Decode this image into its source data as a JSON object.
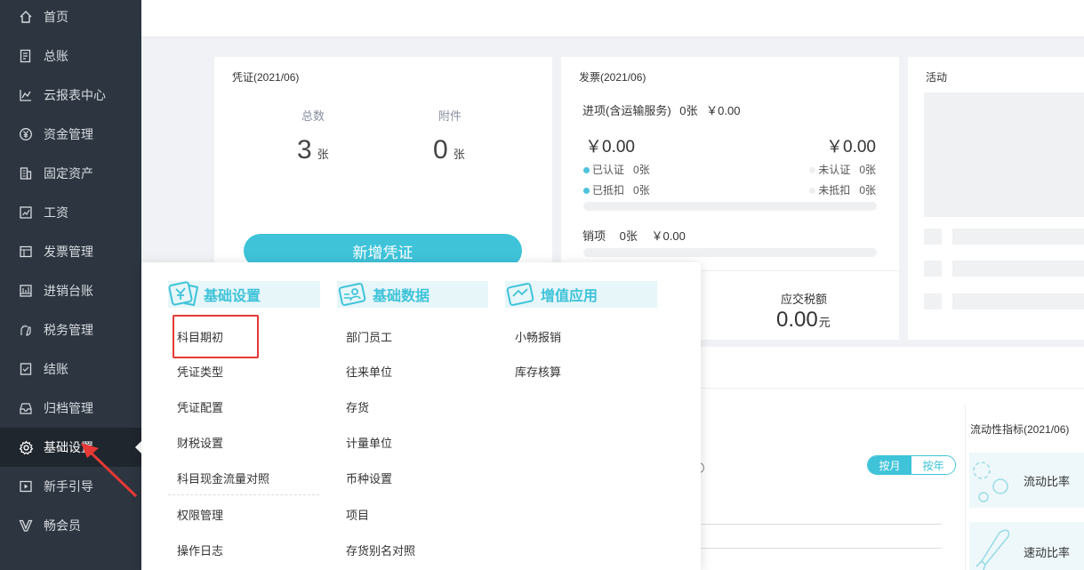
{
  "sidebar": {
    "items": [
      {
        "label": "首页",
        "icon": "home-icon"
      },
      {
        "label": "总账",
        "icon": "ledger-icon"
      },
      {
        "label": "云报表中心",
        "icon": "report-chart-icon"
      },
      {
        "label": "资金管理",
        "icon": "yen-wallet-icon"
      },
      {
        "label": "固定资产",
        "icon": "building-icon"
      },
      {
        "label": "工资",
        "icon": "salary-chart-icon"
      },
      {
        "label": "发票管理",
        "icon": "invoice-icon"
      },
      {
        "label": "进销台账",
        "icon": "stock-ledger-icon"
      },
      {
        "label": "税务管理",
        "icon": "tax-hand-icon"
      },
      {
        "label": "结账",
        "icon": "close-account-icon"
      },
      {
        "label": "归档管理",
        "icon": "archive-icon"
      },
      {
        "label": "基础设置",
        "icon": "gear-icon"
      },
      {
        "label": "新手引导",
        "icon": "play-guide-icon"
      },
      {
        "label": "畅会员",
        "icon": "vip-v-icon"
      }
    ],
    "active_index": 11
  },
  "voucher": {
    "title": "凭证(2021/06)",
    "total_label": "总数",
    "total_value": "3",
    "attach_label": "附件",
    "attach_value": "0",
    "unit": "张",
    "new_button": "新增凭证"
  },
  "invoice": {
    "title": "发票(2021/06)",
    "input_label": "进项(含运输服务)",
    "input_count": "0张",
    "input_amount": "￥0.00",
    "left_amount": "￥0.00",
    "right_amount": "￥0.00",
    "certified": "已认证",
    "certified_count": "0张",
    "uncertified": "未认证",
    "uncertified_count": "0张",
    "deducted": "已抵扣",
    "deducted_count": "0张",
    "undeducted": "未抵扣",
    "undeducted_count": "0张",
    "output_label": "销项",
    "output_count": "0张",
    "output_amount": "￥0.00",
    "tax_label": "应交税额",
    "tax_value": "0.00",
    "tax_unit": "元"
  },
  "activity": {
    "title": "活动"
  },
  "liquidity": {
    "title": "流动性指标(2021/06)",
    "current_ratio": "流动比率",
    "quick_ratio": "速动比率",
    "toggle_month": "按月",
    "toggle_year": "按年"
  },
  "dropdown": {
    "columns": [
      {
        "title": "基础设置",
        "icon": "yen-card-icon",
        "items": [
          "科目期初",
          "凭证类型",
          "凭证配置",
          "财税设置",
          "科目现金流量对照",
          "权限管理",
          "操作日志"
        ]
      },
      {
        "title": "基础数据",
        "icon": "id-card-icon",
        "items": [
          "部门员工",
          "往来单位",
          "存货",
          "计量单位",
          "币种设置",
          "项目",
          "存货别名对照"
        ]
      },
      {
        "title": "增值应用",
        "icon": "app-card-icon",
        "items": [
          "小畅报销",
          "库存核算"
        ]
      }
    ]
  },
  "colors": {
    "accent": "#3ec3d9",
    "sidebar_bg": "#2d3540",
    "highlight": "#e53935"
  }
}
